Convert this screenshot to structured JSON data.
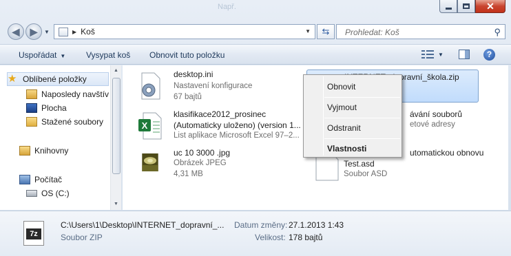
{
  "window": {
    "title": "Např.",
    "minimize_icon": "minimize-icon",
    "maximize_icon": "maximize-icon",
    "close_icon": "close-icon"
  },
  "address": {
    "back_icon": "back-arrow-icon",
    "forward_icon": "forward-arrow-icon",
    "location": "Koš",
    "refresh_icon": "refresh-icon",
    "search_placeholder": "Prohledat: Koš",
    "search_icon": "magnifier-icon"
  },
  "toolbar": {
    "organize": "Uspořádat",
    "empty_bin": "Vysypat koš",
    "restore": "Obnovit tuto položku",
    "views_icon": "views-icon",
    "preview_pane_icon": "preview-pane-icon",
    "help_icon": "help-icon"
  },
  "nav": {
    "items": [
      {
        "label": "Oblíbené položky",
        "icon": "star-icon"
      },
      {
        "label": "Naposledy navštív",
        "icon": "recent-places-icon"
      },
      {
        "label": "Plocha",
        "icon": "desktop-icon"
      },
      {
        "label": "Stažené soubory",
        "icon": "downloads-folder-icon"
      },
      {
        "label": "Knihovny",
        "icon": "libraries-icon"
      },
      {
        "label": "Počítač",
        "icon": "computer-icon"
      },
      {
        "label": "OS (C:)",
        "icon": "drive-icon"
      }
    ]
  },
  "files": [
    {
      "name": "desktop.ini",
      "line2": "",
      "type": "Nastavení konfigurace",
      "size": "67 bajtů",
      "icon": "settings-file-icon"
    },
    {
      "name": "klasifikace2012_prosinec",
      "line2": "(Automaticky uloženo) (version 1...",
      "type": "List aplikace Microsoft Excel 97–2...",
      "size": "",
      "icon": "excel-file-icon"
    },
    {
      "name": "uc 10 3000 .jpg",
      "line2": "",
      "type": "Obrázek JPEG",
      "size": "4,31 MB",
      "icon": "jpeg-thumbnail-icon"
    },
    {
      "name": "INTERNET_dopravní_škola.zip",
      "line2": "",
      "type": "",
      "size": "",
      "icon": "zip-file-icon"
    },
    {
      "name": "ávání souborů",
      "line2": "etové adresy",
      "type": "",
      "size": "",
      "icon": ""
    },
    {
      "name": "utomatickou obnovu",
      "line2": "Test.asd",
      "type": "Soubor ASD",
      "size": "",
      "icon": "asd-file-icon"
    }
  ],
  "context_menu": {
    "items": [
      {
        "label": "Obnovit"
      },
      {
        "label": "Vyjmout"
      },
      {
        "label": "Odstranit"
      },
      {
        "label": "Vlastnosti"
      }
    ]
  },
  "details": {
    "icon": "7zip-icon",
    "icon_text": "7z",
    "path": "C:\\Users\\1\\Desktop\\INTERNET_dopravní_...",
    "type": "Soubor ZIP",
    "modified_label": "Datum změny:",
    "modified_value": "27.1.2013 1:43",
    "size_label": "Velikost:",
    "size_value": "178 bajtů"
  }
}
